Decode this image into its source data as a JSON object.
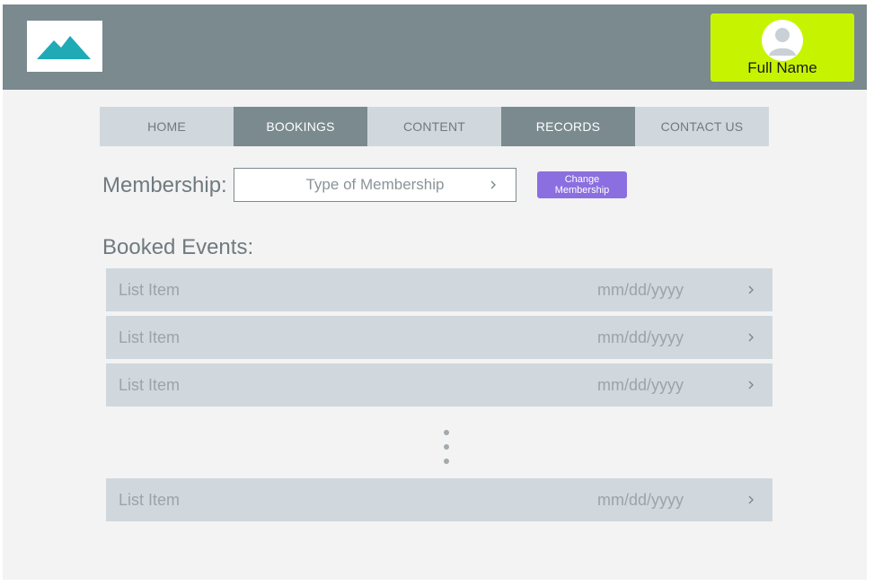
{
  "header": {
    "user_name": "Full Name"
  },
  "nav": {
    "tabs": [
      "HOME",
      "BOOKINGS",
      "CONTENT",
      "RECORDS",
      "CONTACT US"
    ]
  },
  "membership": {
    "label": "Membership:",
    "value": "Type of Membership",
    "change_button": "Change Membership"
  },
  "booked_events": {
    "title": "Booked Events:",
    "items": [
      {
        "label": "List Item",
        "date": "mm/dd/yyyy"
      },
      {
        "label": "List Item",
        "date": "mm/dd/yyyy"
      },
      {
        "label": "List Item",
        "date": "mm/dd/yyyy"
      },
      {
        "label": "List Item",
        "date": "mm/dd/yyyy"
      }
    ]
  },
  "colors": {
    "header_bg": "#7a8a8f",
    "user_box": "#c6f400",
    "accent_button": "#8b6fe0",
    "logo_mountain": "#1faab6",
    "list_bg": "#d0d8de"
  },
  "icons": {
    "logo": "mountain-logo-icon",
    "avatar": "user-avatar-icon",
    "chevron": "chevron-right-icon",
    "ellipsis": "vertical-ellipsis-icon"
  }
}
